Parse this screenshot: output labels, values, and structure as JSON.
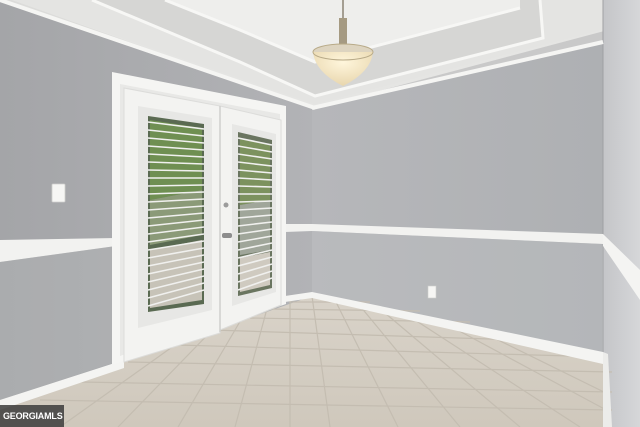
{
  "watermark": {
    "text": "GEORGIAMLS"
  },
  "colors": {
    "wall_upper": "#a9aaad",
    "wall_lower": "#b9babc",
    "trim": "#f4f4f2",
    "ceiling": "#ececea",
    "floor": "#d8d1c6",
    "grout": "#c6bfb3"
  }
}
